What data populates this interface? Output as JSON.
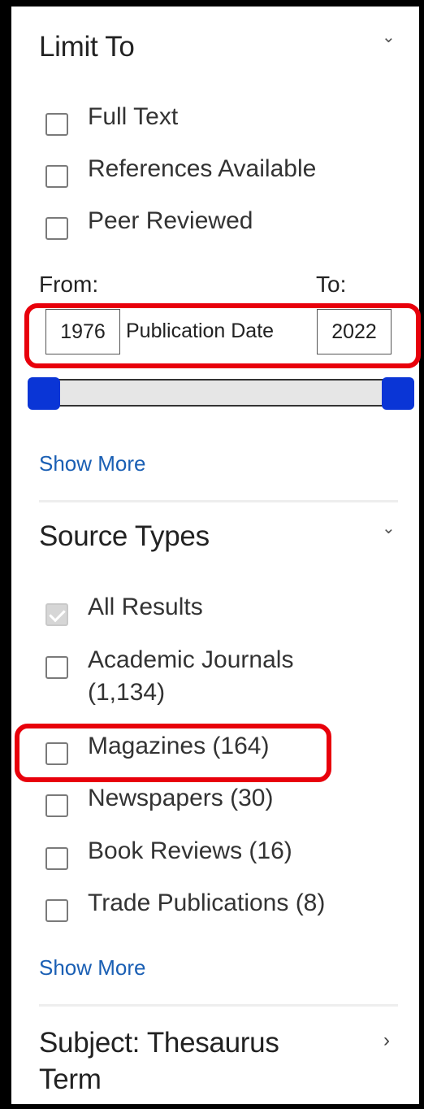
{
  "limit_to": {
    "heading": "Limit To",
    "options": [
      {
        "label": "Full Text",
        "checked": false
      },
      {
        "label": "References Available",
        "checked": false
      },
      {
        "label": "Peer Reviewed",
        "checked": false
      }
    ],
    "from_label": "From:",
    "to_label": "To:",
    "from_value": "1976",
    "to_value": "2022",
    "date_label": "Publication Date",
    "show_more": "Show More"
  },
  "source_types": {
    "heading": "Source Types",
    "options": [
      {
        "label": "All Results",
        "checked": true
      },
      {
        "label": "Academic Journals",
        "label_line2": "(1,134)",
        "checked": false
      },
      {
        "label": "Magazines (164)",
        "checked": false
      },
      {
        "label": "Newspapers (30)",
        "checked": false
      },
      {
        "label": "Book Reviews (16)",
        "checked": false
      },
      {
        "label": "Trade Publications (8)",
        "checked": false
      }
    ],
    "show_more": "Show More"
  },
  "subject": {
    "heading_line1": "Subject: Thesaurus",
    "heading_line2": "Term"
  },
  "colors": {
    "highlight": "#e8000b",
    "link": "#1a5fb4",
    "slider_handle": "#0a35d6"
  }
}
